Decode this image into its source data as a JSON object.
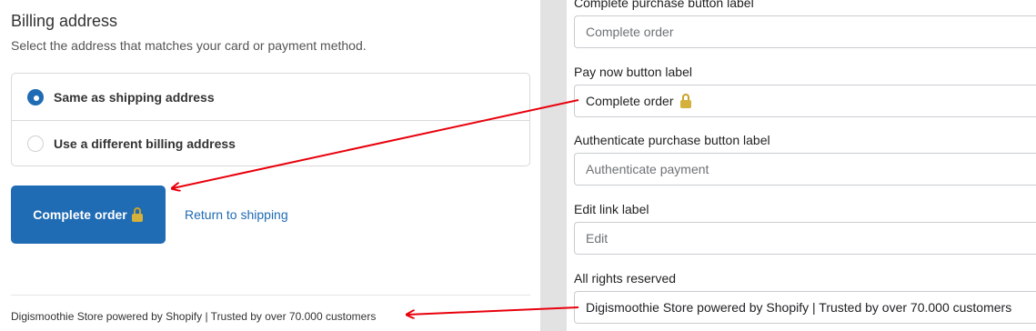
{
  "checkout": {
    "title": "Billing address",
    "subtitle": "Select the address that matches your card or payment method.",
    "options": [
      {
        "label": "Same as shipping address",
        "selected": true
      },
      {
        "label": "Use a different billing address",
        "selected": false
      }
    ],
    "complete_button_label": "Complete order",
    "return_link_label": "Return to shipping",
    "footer_text": "Digismoothie Store powered by Shopify | Trusted by over 70.000 customers",
    "accent_color": "#1f6bb4"
  },
  "settings": {
    "fields": [
      {
        "label": "Complete purchase button label",
        "placeholder": "Complete order",
        "value": ""
      },
      {
        "label": "Pay now button label",
        "placeholder": "",
        "value": "Complete order"
      },
      {
        "label": "Authenticate purchase button label",
        "placeholder": "Authenticate payment",
        "value": ""
      },
      {
        "label": "Edit link label",
        "placeholder": "Edit",
        "value": ""
      },
      {
        "label": "All rights reserved",
        "placeholder": "",
        "value": "Digismoothie Store powered by Shopify | Trusted by over 70.000 customers"
      }
    ]
  },
  "annotations": {
    "arrow_color": "#e8000b"
  },
  "icons": {
    "lock": "lock-icon",
    "radio_checked": "radio-checked-icon",
    "radio_unchecked": "radio-unchecked-icon"
  }
}
